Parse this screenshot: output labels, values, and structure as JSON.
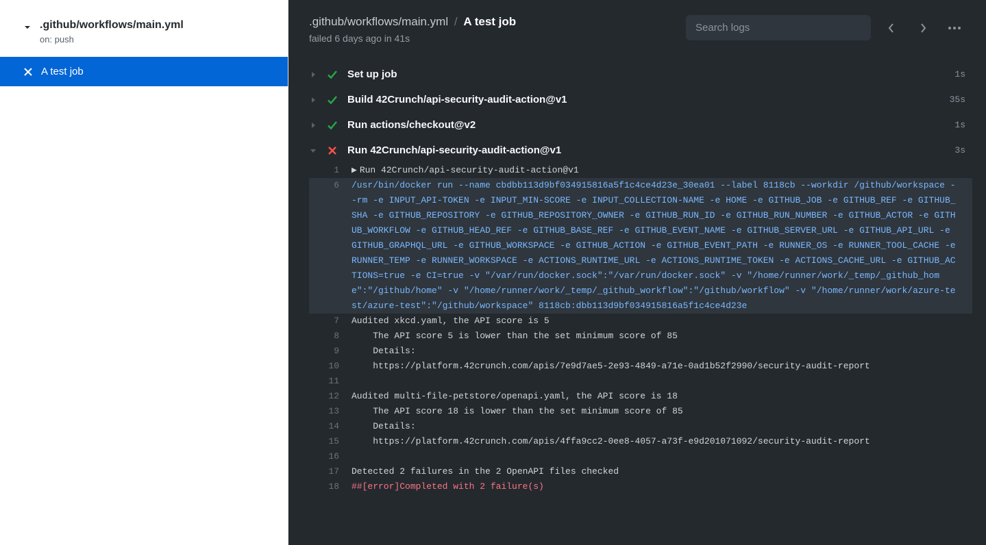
{
  "sidebar": {
    "workflow_title": ".github/workflows/main.yml",
    "workflow_trigger": "on: push",
    "job_name": "A test job"
  },
  "header": {
    "breadcrumb_path": ".github/workflows/main.yml",
    "breadcrumb_current": "A test job",
    "sub_status": "failed 6 days ago in 41s",
    "search_placeholder": "Search logs"
  },
  "steps": {
    "s0": {
      "name": "Set up job",
      "time": "1s",
      "status": "success"
    },
    "s1": {
      "name": "Build 42Crunch/api-security-audit-action@v1",
      "time": "35s",
      "status": "success"
    },
    "s2": {
      "name": "Run actions/checkout@v2",
      "time": "1s",
      "status": "success"
    },
    "s3": {
      "name": "Run 42Crunch/api-security-audit-action@v1",
      "time": "3s",
      "status": "failure"
    }
  },
  "logs": {
    "l1": {
      "n": "1",
      "t": "Run 42Crunch/api-security-audit-action@v1"
    },
    "l6": {
      "n": "6",
      "t": "/usr/bin/docker run --name cbdbb113d9bf034915816a5f1c4ce4d23e_30ea01 --label 8118cb --workdir /github/workspace --rm -e INPUT_API-TOKEN -e INPUT_MIN-SCORE -e INPUT_COLLECTION-NAME -e HOME -e GITHUB_JOB -e GITHUB_REF -e GITHUB_SHA -e GITHUB_REPOSITORY -e GITHUB_REPOSITORY_OWNER -e GITHUB_RUN_ID -e GITHUB_RUN_NUMBER -e GITHUB_ACTOR -e GITHUB_WORKFLOW -e GITHUB_HEAD_REF -e GITHUB_BASE_REF -e GITHUB_EVENT_NAME -e GITHUB_SERVER_URL -e GITHUB_API_URL -e GITHUB_GRAPHQL_URL -e GITHUB_WORKSPACE -e GITHUB_ACTION -e GITHUB_EVENT_PATH -e RUNNER_OS -e RUNNER_TOOL_CACHE -e RUNNER_TEMP -e RUNNER_WORKSPACE -e ACTIONS_RUNTIME_URL -e ACTIONS_RUNTIME_TOKEN -e ACTIONS_CACHE_URL -e GITHUB_ACTIONS=true -e CI=true -v \"/var/run/docker.sock\":\"/var/run/docker.sock\" -v \"/home/runner/work/_temp/_github_home\":\"/github/home\" -v \"/home/runner/work/_temp/_github_workflow\":\"/github/workflow\" -v \"/home/runner/work/azure-test/azure-test\":\"/github/workspace\" 8118cb:dbb113d9bf034915816a5f1c4ce4d23e"
    },
    "l7": {
      "n": "7",
      "t": "Audited xkcd.yaml, the API score is 5"
    },
    "l8": {
      "n": "8",
      "t": "    The API score 5 is lower than the set minimum score of 85"
    },
    "l9": {
      "n": "9",
      "t": "    Details:"
    },
    "l10": {
      "n": "10",
      "t": "    https://platform.42crunch.com/apis/7e9d7ae5-2e93-4849-a71e-0ad1b52f2990/security-audit-report"
    },
    "l11": {
      "n": "11",
      "t": ""
    },
    "l12": {
      "n": "12",
      "t": "Audited multi-file-petstore/openapi.yaml, the API score is 18"
    },
    "l13": {
      "n": "13",
      "t": "    The API score 18 is lower than the set minimum score of 85"
    },
    "l14": {
      "n": "14",
      "t": "    Details:"
    },
    "l15": {
      "n": "15",
      "t": "    https://platform.42crunch.com/apis/4ffa9cc2-0ee8-4057-a73f-e9d201071092/security-audit-report"
    },
    "l16": {
      "n": "16",
      "t": ""
    },
    "l17": {
      "n": "17",
      "t": "Detected 2 failures in the 2 OpenAPI files checked"
    },
    "l18": {
      "n": "18",
      "t": "##[error]Completed with 2 failure(s)"
    }
  }
}
